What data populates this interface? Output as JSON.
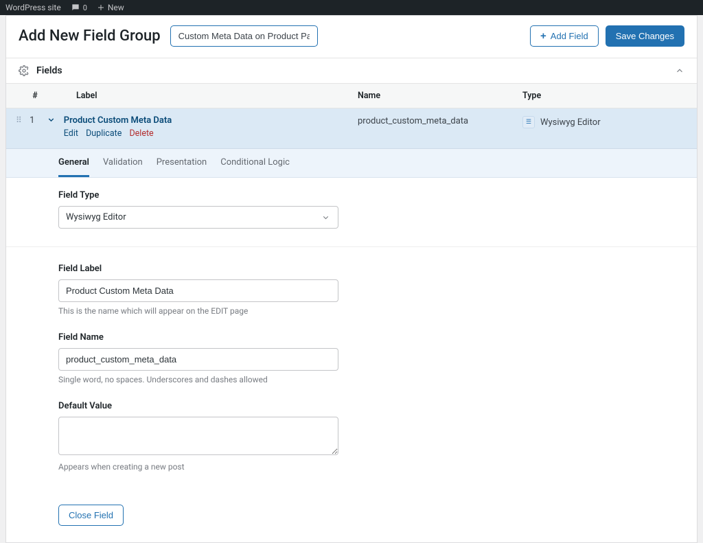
{
  "adminbar": {
    "site": "WordPress site",
    "comments": "0",
    "new": "New"
  },
  "header": {
    "page_title": "Add New Field Group",
    "title_input_value": "Custom Meta Data on Product Pages",
    "add_field": "Add Field",
    "save": "Save Changes"
  },
  "panel": {
    "title": "Fields"
  },
  "columns": {
    "order": "#",
    "label": "Label",
    "name": "Name",
    "type": "Type"
  },
  "row": {
    "order": "1",
    "label": "Product Custom Meta Data",
    "name": "product_custom_meta_data",
    "type": "Wysiwyg Editor",
    "actions": {
      "edit": "Edit",
      "duplicate": "Duplicate",
      "delete": "Delete"
    }
  },
  "tabs": {
    "general": "General",
    "validation": "Validation",
    "presentation": "Presentation",
    "conditional": "Conditional Logic"
  },
  "form": {
    "field_type": {
      "label": "Field Type",
      "value": "Wysiwyg Editor"
    },
    "field_label": {
      "label": "Field Label",
      "value": "Product Custom Meta Data",
      "help": "This is the name which will appear on the EDIT page"
    },
    "field_name": {
      "label": "Field Name",
      "value": "product_custom_meta_data",
      "help": "Single word, no spaces. Underscores and dashes allowed"
    },
    "default_value": {
      "label": "Default Value",
      "value": "",
      "help": "Appears when creating a new post"
    },
    "close": "Close Field"
  }
}
